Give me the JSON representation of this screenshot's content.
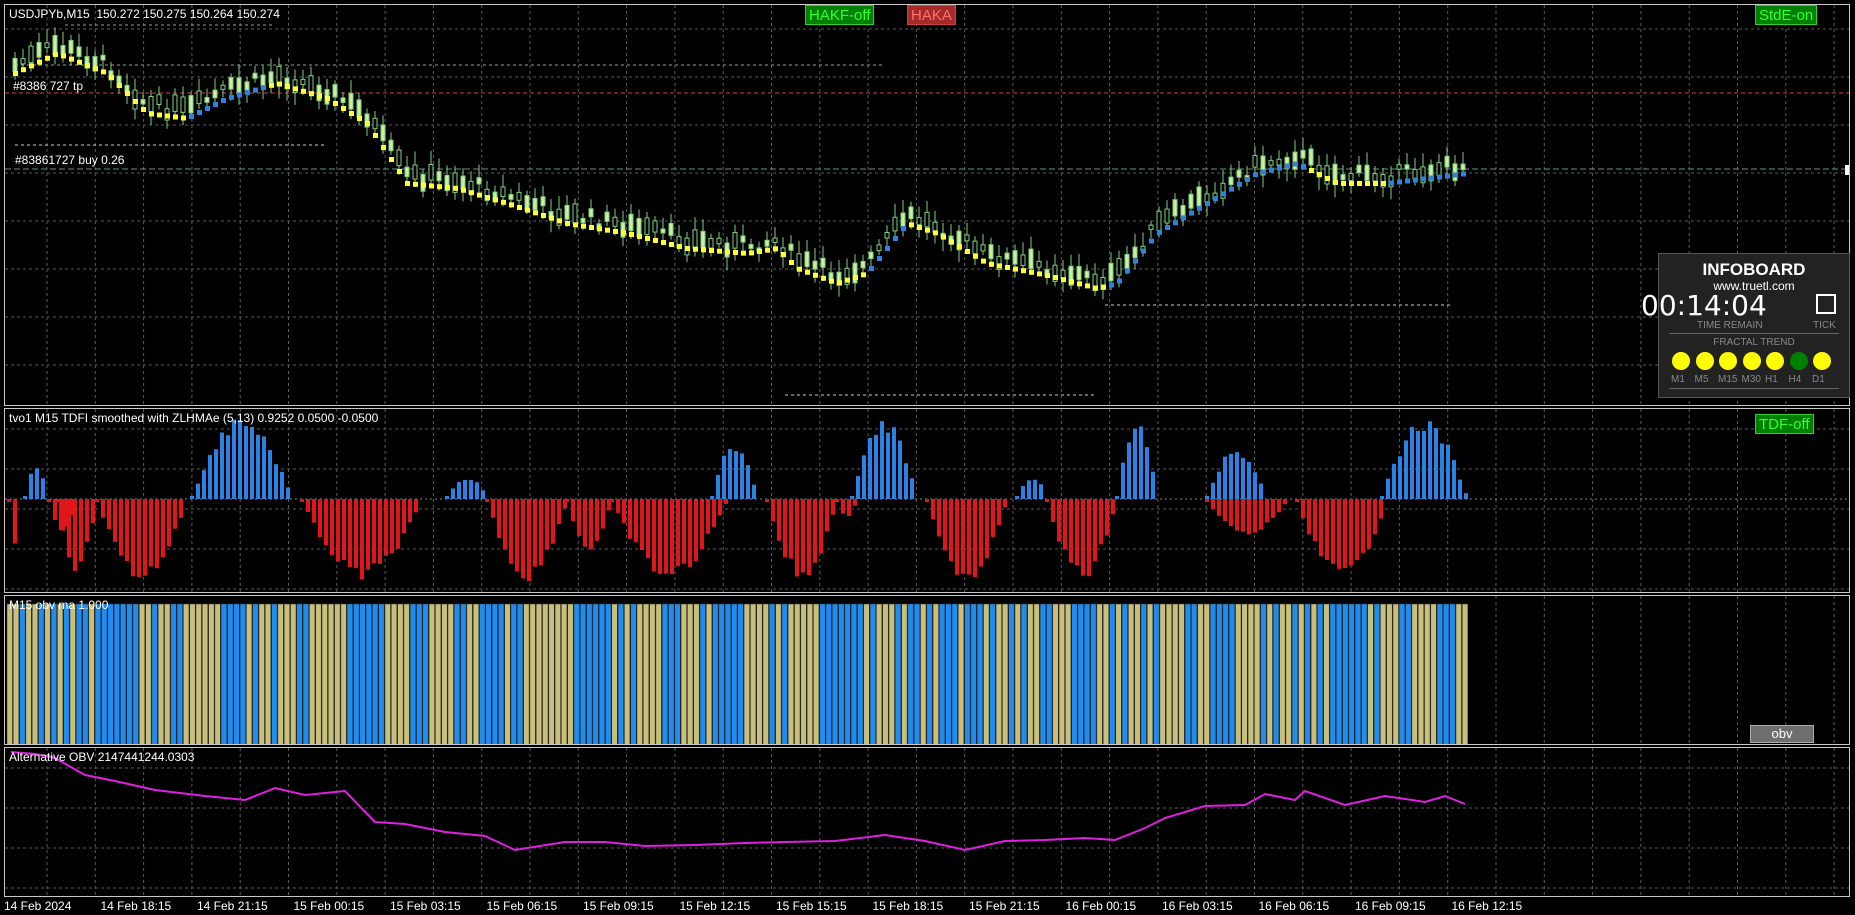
{
  "price_pane": {
    "label": "USDJPYb,M15  150.272 150.275 150.264 150.274",
    "order_marker_1": "#8386 727 tp",
    "order_marker_2": "#83861727 buy 0.26",
    "buttons": {
      "hakf": "HAKF-off",
      "haka": "HAKA",
      "stde": "StdE-on"
    }
  },
  "infoboard": {
    "title": "INFOBOARD",
    "url": "www.truetl.com",
    "timer": "00:14:04",
    "time_remain_label": "TIME REMAIN",
    "tick_label": "TICK",
    "fractal_trend_label": "FRACTAL TREND",
    "timeframes": [
      {
        "tf": "M1",
        "color": "#ffff00"
      },
      {
        "tf": "M5",
        "color": "#ffff00"
      },
      {
        "tf": "M15",
        "color": "#ffff00"
      },
      {
        "tf": "M30",
        "color": "#ffff00"
      },
      {
        "tf": "H1",
        "color": "#ffff00"
      },
      {
        "tf": "H4",
        "color": "#008000"
      },
      {
        "tf": "D1",
        "color": "#ffff00"
      }
    ]
  },
  "tdfi_pane": {
    "label": "tvo1 M15 TDFI smoothed with ZLHMAe (5,13) 0.9252 0.0500 -0.0500",
    "button": "TDF-off"
  },
  "obv_pane": {
    "label": "M15 obv ma 1.000",
    "button": "obv"
  },
  "aobv_pane": {
    "label": "Alternative OBV 2147441244.0303"
  },
  "time_axis": [
    "14 Feb 2024",
    "14 Feb 18:15",
    "14 Feb 21:15",
    "15 Feb 00:15",
    "15 Feb 03:15",
    "15 Feb 06:15",
    "15 Feb 09:15",
    "15 Feb 12:15",
    "15 Feb 15:15",
    "15 Feb 18:15",
    "15 Feb 21:15",
    "16 Feb 00:15",
    "16 Feb 03:15",
    "16 Feb 06:15",
    "16 Feb 09:15",
    "16 Feb 12:15"
  ],
  "colors": {
    "up": "#2a82e4",
    "down": "#e0161a",
    "obv_a": "#c8bf7a",
    "obv_b": "#1e8cf0",
    "aobv": "#e020e0",
    "grid": "#5a5a5a"
  }
}
